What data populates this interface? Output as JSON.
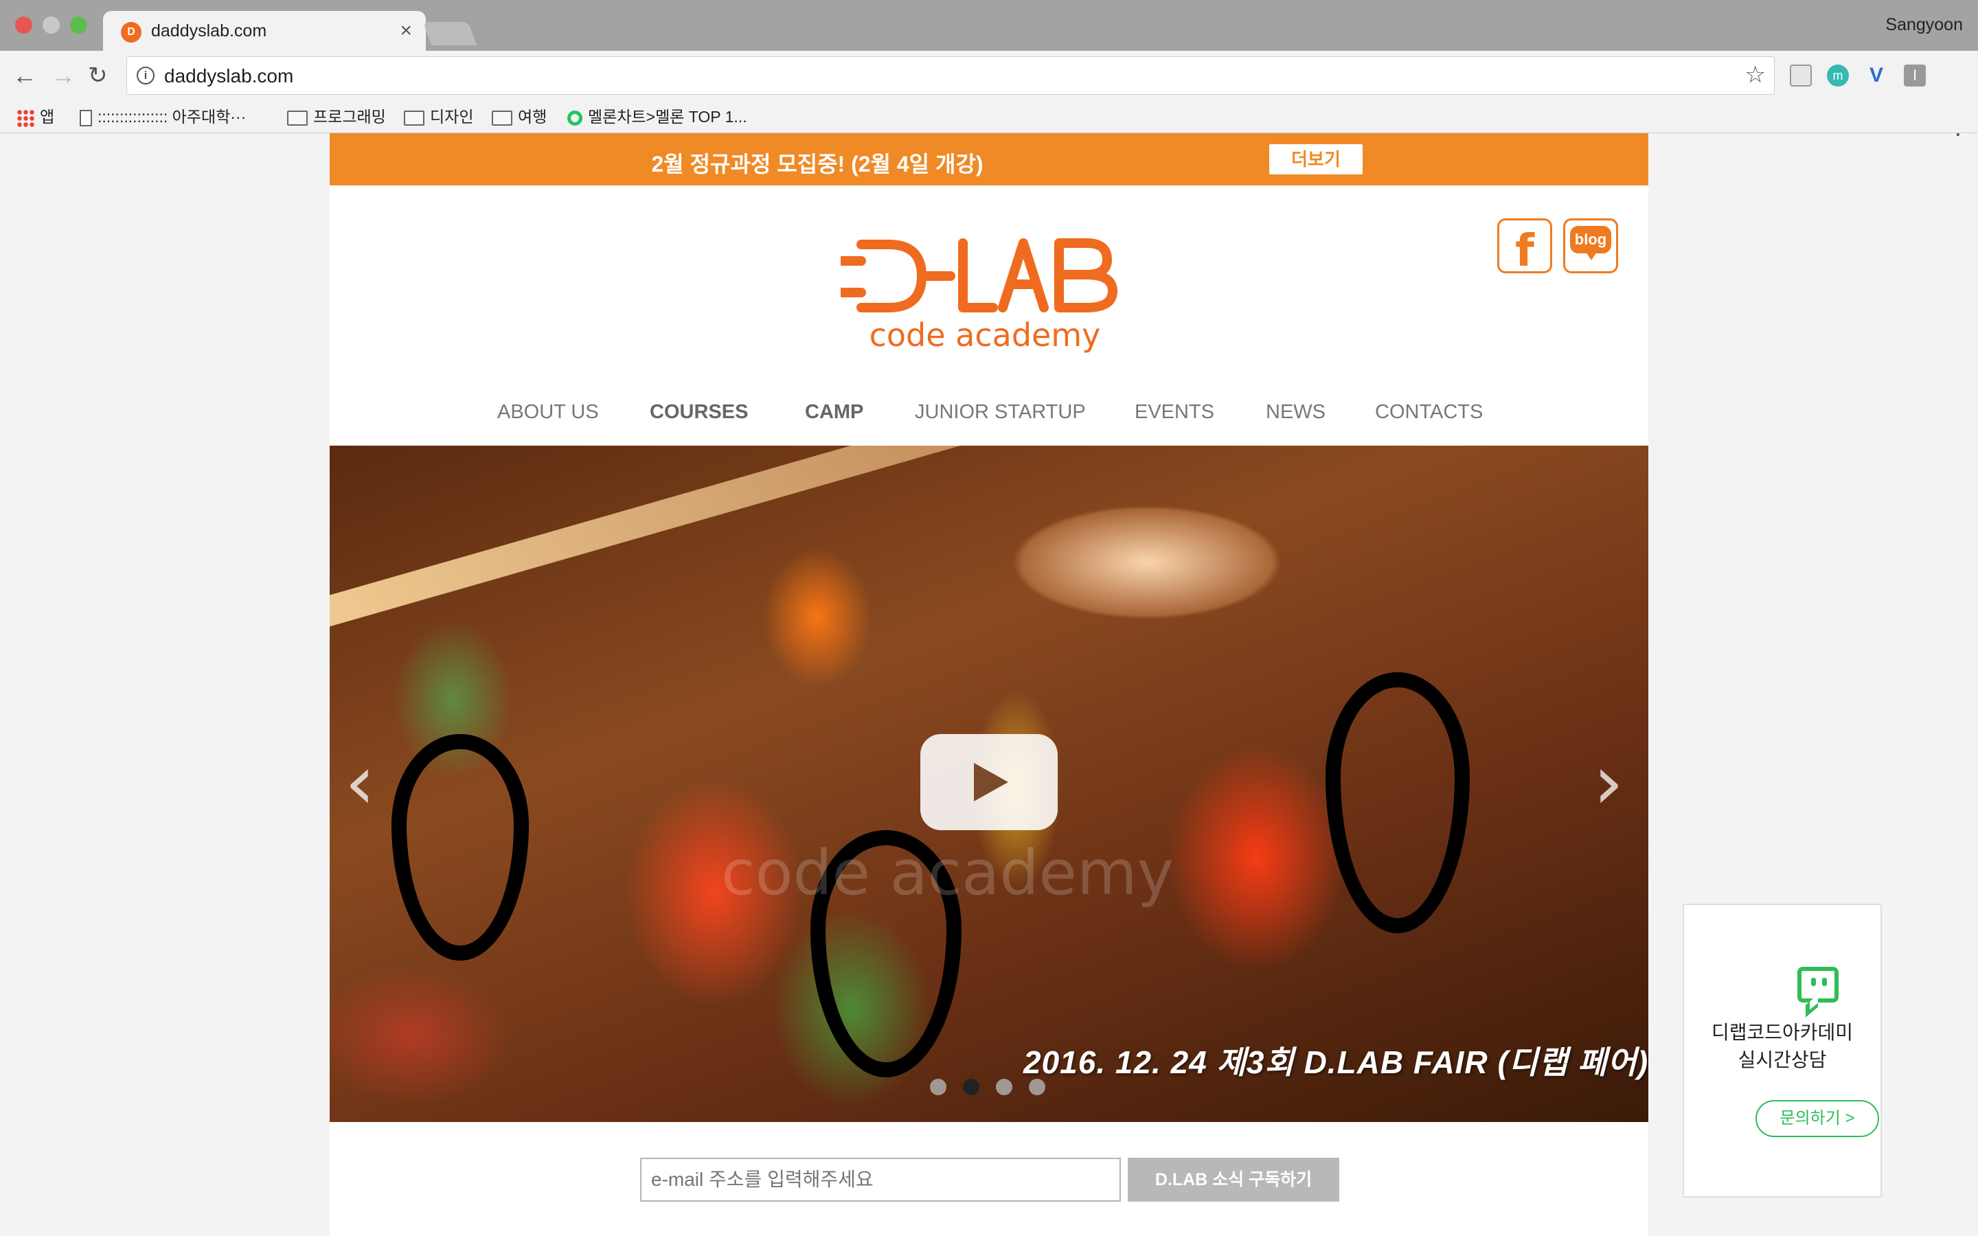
{
  "browser": {
    "tab_title": "daddyslab.com",
    "tab_close": "×",
    "profile_name": "Sangyoon",
    "url": "daddyslab.com",
    "back_icon": "←",
    "forward_icon": "→",
    "reload_icon": "↻",
    "star_icon": "☆",
    "menu_icon": "⋮",
    "extensions": [
      "m",
      "V",
      "I"
    ],
    "bookmarks": [
      {
        "label": "앱",
        "icon": "apps-grid-icon"
      },
      {
        "label": ":::::::::::::::: 아주대학···",
        "icon": "page-icon"
      },
      {
        "label": "프로그래밍",
        "icon": "folder-icon"
      },
      {
        "label": "디자인",
        "icon": "folder-icon"
      },
      {
        "label": "여행",
        "icon": "folder-icon"
      },
      {
        "label": "멜론차트>멜론 TOP 1...",
        "icon": "melon-icon"
      }
    ]
  },
  "site": {
    "accent_color": "#ef8a26",
    "announcement": {
      "text": "2월 정규과정 모집중! (2월 4일 개강)",
      "button": "더보기"
    },
    "logo": {
      "wordmark": "D-LAB",
      "tagline": "code academy"
    },
    "social": {
      "facebook": "f",
      "blog": "blog"
    },
    "nav": [
      "ABOUT US",
      "COURSES",
      "CAMP",
      "JUNIOR STARTUP",
      "EVENTS",
      "NEWS",
      "CONTACTS"
    ],
    "hero": {
      "caption": "2016. 12. 24  제3회 D.LAB FAIR (디랩 페어)",
      "watermark": "code academy",
      "prev_icon": "‹",
      "next_icon": "›",
      "slide_count": 4,
      "active_slide": 2
    },
    "subscribe": {
      "placeholder": "e-mail 주소를 입력해주세요",
      "button": "D.LAB 소식 구독하기"
    },
    "chat_widget": {
      "title_line1": "디랩코드아카데미",
      "title_line2": "실시간상담",
      "button": "문의하기 >"
    }
  }
}
